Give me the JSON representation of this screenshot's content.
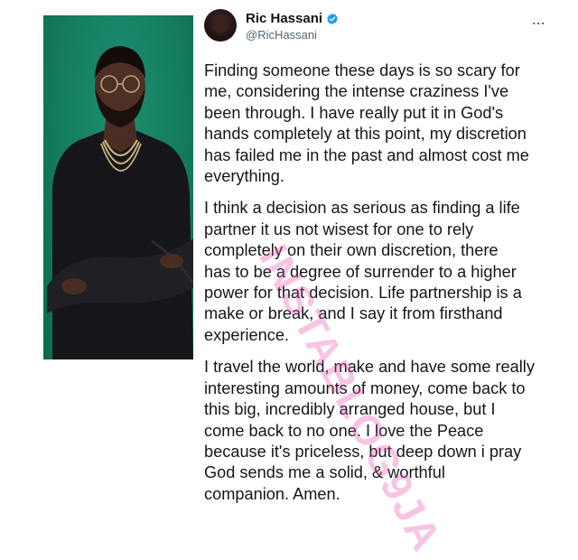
{
  "photo": {
    "alt": "",
    "background_color": "#137a5c"
  },
  "tweet": {
    "display_name": "Ric Hassani",
    "handle": "@RicHassani",
    "verified": true,
    "verified_color": "#1d9bf0",
    "more_icon": "...",
    "paragraphs": [
      "Finding someone these days is so scary for\nme, considering the intense craziness I've\nbeen through. I have really put it in God's\nhands completely at this point, my discretion\nhas failed me in the past and almost cost me\neverything.",
      "I think a decision as serious as finding a life\npartner it us not wisest for one to rely\ncompletely on their own discretion, there\nhas to be a degree of surrender to a higher\npower for that decision. Life partnership is a\nmake or break, and I say it from firsthand\nexperience.",
      "I travel the world, make and have some really\ninteresting amounts of money, come back to\nthis big, incredibly arranged house, but I\ncome back to no one. I love the Peace\nbecause it's priceless, but deep down i pray\nGod sends me a solid, & worthful\ncompanion. Amen."
    ]
  },
  "watermark": {
    "text": "INSTABLOG9JA",
    "color": "#e846aa"
  }
}
